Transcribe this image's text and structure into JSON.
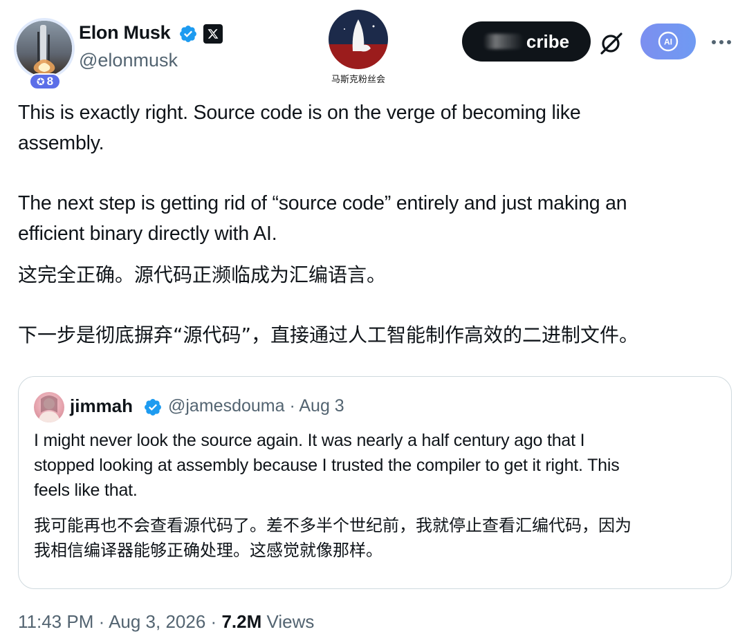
{
  "author": {
    "name": "Elon Musk",
    "handle": "@elonmusk",
    "affiliation_count": "8",
    "avatar_icon": "rocket-avatar-icon",
    "verified_color": "#1d9bf0"
  },
  "watermark": {
    "text": "马斯克粉丝会",
    "colors": {
      "top": "#1c2a4a",
      "bottom": "#9b1c1c"
    }
  },
  "header_actions": {
    "subscribe_label": "cribe",
    "grok_icon": "grok-icon",
    "ai_label": "AI",
    "more_icon": "more-dots-icon"
  },
  "tweet": {
    "en_paragraph_1_line_1": "This is exactly right. Source code is on the verge of becoming like",
    "en_paragraph_1_line_2": "assembly.",
    "en_paragraph_2_line_1": "The next step is getting rid of “source code” entirely and just making an",
    "en_paragraph_2_line_2": "efficient binary directly with AI.",
    "cn_line_1": "这完全正确。源代码正濒临成为汇编语言。",
    "cn_line_2": "下一步是彻底摒弃“源代码”，直接通过人工智能制作高效的二进制文件。"
  },
  "quoted_tweet": {
    "name": "jimmah",
    "handle": "@jamesdouma",
    "separator": "·",
    "date": "Aug 3",
    "en_line_1": "I might never look the source again. It was nearly a half century ago that I",
    "en_line_2": "stopped looking at assembly because I trusted the compiler to get it right.  This",
    "en_line_3": "feels like that.",
    "cn_line_1": "我可能再也不会查看源代码了。差不多半个世纪前，我就停止查看汇编代码，因为",
    "cn_line_2": "我相信编译器能够正确处理。这感觉就像那样。"
  },
  "footer": {
    "time": "11:43 PM",
    "separator": "·",
    "date": "Aug 3, 2026",
    "views_count": "7.2M",
    "views_label": "Views"
  }
}
